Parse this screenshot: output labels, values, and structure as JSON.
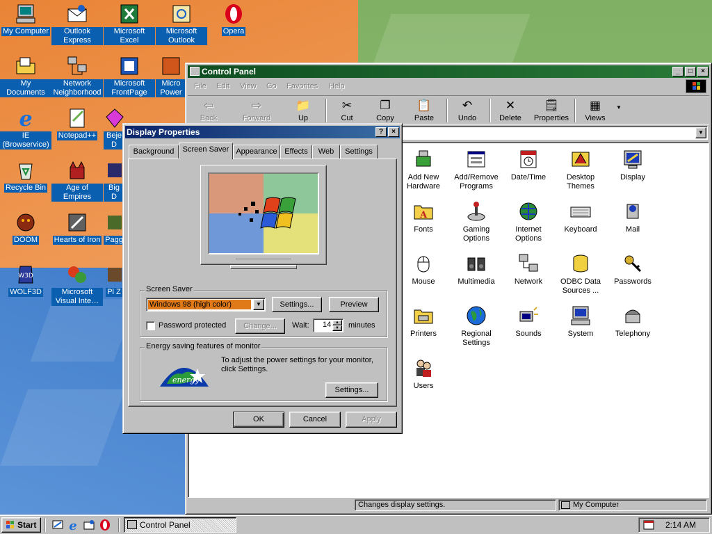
{
  "desktop": {
    "icons": [
      {
        "label": "My Computer",
        "icon": "my-computer-icon"
      },
      {
        "label": "Outlook Express",
        "icon": "outlook-express-icon"
      },
      {
        "label": "Microsoft Excel",
        "icon": "excel-icon"
      },
      {
        "label": "Microsoft Outlook",
        "icon": "outlook-icon"
      },
      {
        "label": "Opera",
        "icon": "opera-icon"
      },
      {
        "label": "My Documents",
        "icon": "my-documents-icon"
      },
      {
        "label": "Network Neighborhood",
        "icon": "network-neighborhood-icon"
      },
      {
        "label": "Microsoft FrontPage",
        "icon": "frontpage-icon"
      },
      {
        "label": "Micro Power",
        "icon": "powerpoint-icon"
      },
      {
        "label": "IE (Browservice)",
        "icon": "internet-explorer-icon"
      },
      {
        "label": "Notepad++",
        "icon": "notepad-plus-plus-icon"
      },
      {
        "label": "Beje D",
        "icon": "bejeweled-icon"
      },
      {
        "label": "Recycle Bin",
        "icon": "recycle-bin-icon"
      },
      {
        "label": "Age of Empires",
        "icon": "age-of-empires-icon"
      },
      {
        "label": "Big D",
        "icon": "game-icon"
      },
      {
        "label": "DOOM",
        "icon": "doom-icon"
      },
      {
        "label": "Hearts of Iron",
        "icon": "hearts-of-iron-icon"
      },
      {
        "label": "Pagg",
        "icon": "game-icon"
      },
      {
        "label": "WOLF3D",
        "icon": "wolf3d-icon"
      },
      {
        "label": "Microsoft Visual Inte…",
        "icon": "visual-interdev-icon"
      },
      {
        "label": "Pl Z",
        "icon": "game-icon"
      }
    ]
  },
  "control_panel": {
    "title": "Control Panel",
    "menu": [
      "File",
      "Edit",
      "View",
      "Go",
      "Favorites",
      "Help"
    ],
    "toolbar": {
      "back": "Back",
      "forward": "Forward",
      "up": "Up",
      "cut": "Cut",
      "copy": "Copy",
      "paste": "Paste",
      "undo": "Undo",
      "delete": "Delete",
      "properties": "Properties",
      "views": "Views"
    },
    "items": [
      {
        "label": "Add New Hardware",
        "icon": "add-hardware-icon"
      },
      {
        "label": "Add/Remove Programs",
        "icon": "add-remove-programs-icon"
      },
      {
        "label": "Date/Time",
        "icon": "date-time-icon"
      },
      {
        "label": "Desktop Themes",
        "icon": "desktop-themes-icon"
      },
      {
        "label": "Display",
        "icon": "display-icon"
      },
      {
        "label": "Fonts",
        "icon": "fonts-icon"
      },
      {
        "label": "Gaming Options",
        "icon": "gaming-options-icon"
      },
      {
        "label": "Internet Options",
        "icon": "internet-options-icon"
      },
      {
        "label": "Keyboard",
        "icon": "keyboard-icon"
      },
      {
        "label": "Mail",
        "icon": "mail-icon"
      },
      {
        "label": "Mouse",
        "icon": "mouse-icon"
      },
      {
        "label": "Multimedia",
        "icon": "multimedia-icon"
      },
      {
        "label": "Network",
        "icon": "network-icon"
      },
      {
        "label": "ODBC Data Sources ...",
        "icon": "odbc-icon"
      },
      {
        "label": "Passwords",
        "icon": "passwords-icon"
      },
      {
        "label": "Printers",
        "icon": "printers-icon"
      },
      {
        "label": "Regional Settings",
        "icon": "regional-settings-icon"
      },
      {
        "label": "Sounds",
        "icon": "sounds-icon"
      },
      {
        "label": "System",
        "icon": "system-icon"
      },
      {
        "label": "Telephony",
        "icon": "telephony-icon"
      },
      {
        "label": "Users",
        "icon": "users-icon"
      }
    ],
    "status_left": "Changes display settings.",
    "status_right": "My Computer"
  },
  "dialog": {
    "title": "Display Properties",
    "tabs": [
      "Background",
      "Screen Saver",
      "Appearance",
      "Effects",
      "Web",
      "Settings"
    ],
    "active_tab": "Screen Saver",
    "screen_saver_group": "Screen Saver",
    "screen_saver_value": "Windows 98 (high color)",
    "settings_btn": "Settings...",
    "preview_btn": "Preview",
    "password_label": "Password protected",
    "change_btn": "Change...",
    "wait_label": "Wait:",
    "wait_value": "14",
    "minutes_label": "minutes",
    "energy_group": "Energy saving features of monitor",
    "energy_text": "To adjust the power settings for your monitor, click Settings.",
    "energy_settings_btn": "Settings...",
    "ok": "OK",
    "cancel": "Cancel",
    "apply": "Apply"
  },
  "taskbar": {
    "start": "Start",
    "task": "Control Panel",
    "clock": "2:14 AM"
  },
  "colors": {
    "cp_title": "#0e4e21",
    "dialog_title": "#0a246a",
    "selection": "#0a5fb0"
  }
}
